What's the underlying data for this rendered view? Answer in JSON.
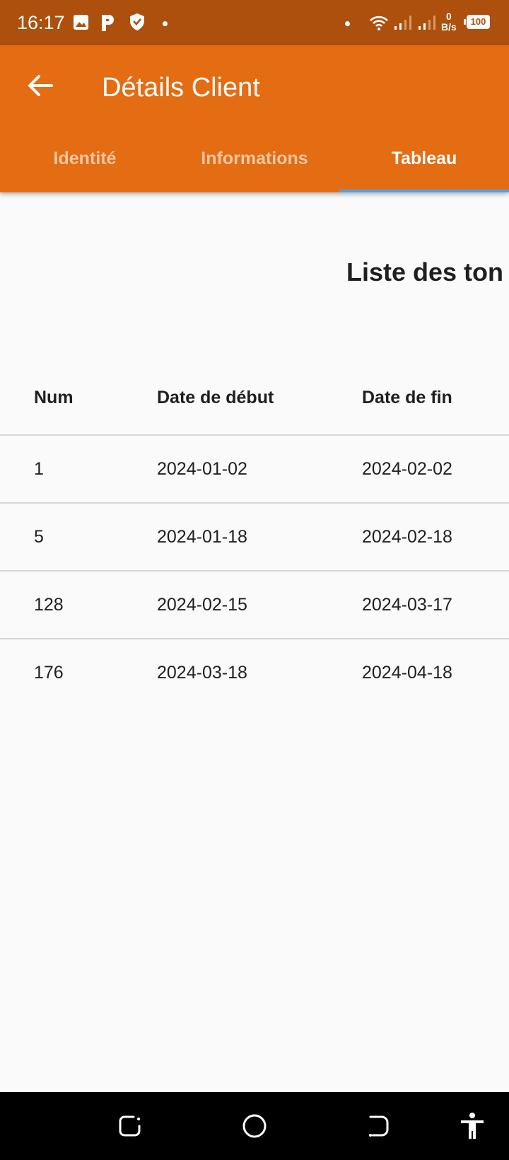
{
  "status_bar": {
    "time": "16:17",
    "net_speed_value": "0",
    "net_speed_unit": "B/s",
    "battery": "100",
    "icons": [
      "image-icon",
      "parking-p-icon",
      "shield-check-icon",
      "dot-icon",
      "dot-icon",
      "wifi-icon",
      "signal-icon",
      "signal-icon",
      "battery-icon"
    ]
  },
  "app_bar": {
    "title": "Détails Client",
    "back_icon": "arrow-back-icon",
    "color": "#e46c13"
  },
  "tabs": [
    {
      "label": "Identité",
      "active": false
    },
    {
      "label": "Informations",
      "active": false
    },
    {
      "label": "Tableau",
      "active": true
    }
  ],
  "tab_indicator_color": "#4ca2ee",
  "content": {
    "title": "Liste des ton",
    "table": {
      "headers": [
        "Num",
        "Date de début",
        "Date de fin"
      ],
      "rows": [
        [
          "1",
          "2024-01-02",
          "2024-02-02"
        ],
        [
          "5",
          "2024-01-18",
          "2024-02-18"
        ],
        [
          "128",
          "2024-02-15",
          "2024-03-17"
        ],
        [
          "176",
          "2024-03-18",
          "2024-04-18"
        ]
      ]
    }
  },
  "nav_bar": {
    "icons": [
      "recents-icon",
      "home-icon",
      "back-nav-icon",
      "accessibility-icon"
    ]
  }
}
